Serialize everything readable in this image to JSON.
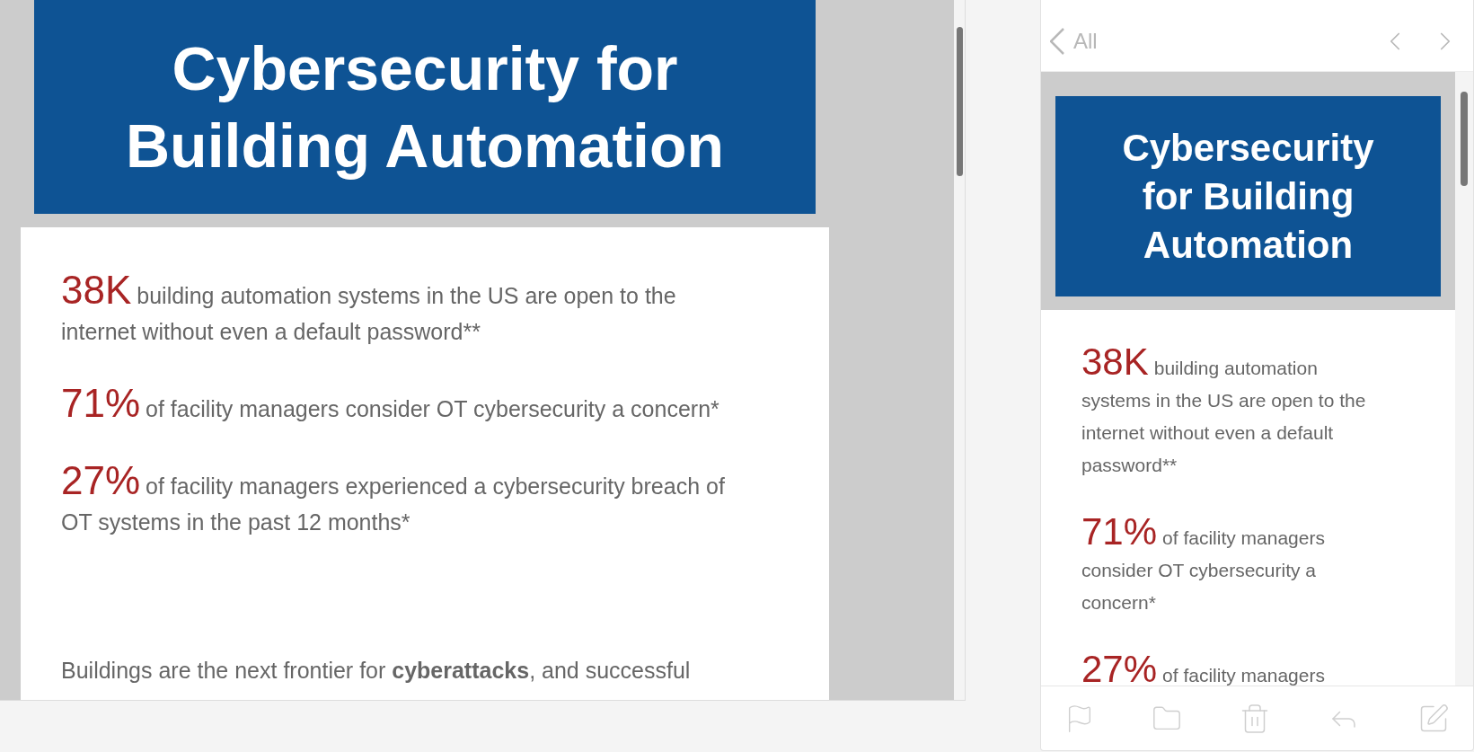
{
  "desktop_preview": {
    "title": "Cybersecurity for Building Automation",
    "stats": [
      {
        "figure": "38K",
        "text": "building automation systems in the US are open to the internet without even a default password**"
      },
      {
        "figure": "71%",
        "text": "of facility managers consider OT cybersecurity a concern*"
      },
      {
        "figure": "27%",
        "text": "of facility managers experienced a cybersecurity breach of OT systems in the past 12 months*"
      }
    ],
    "paragraph": "Buildings are the next frontier for **cyberattacks**, and successful"
  },
  "mobile_preview": {
    "back_label": "All",
    "title": "Cybersecurity for Building Automation",
    "stats": [
      {
        "figure": "38K",
        "text": "building automation systems in the US are open to the internet without even a default password**"
      },
      {
        "figure": "71%",
        "text": "of facility managers consider OT cybersecurity a concern*"
      },
      {
        "figure": "27%",
        "text": "of facility managers"
      }
    ]
  }
}
